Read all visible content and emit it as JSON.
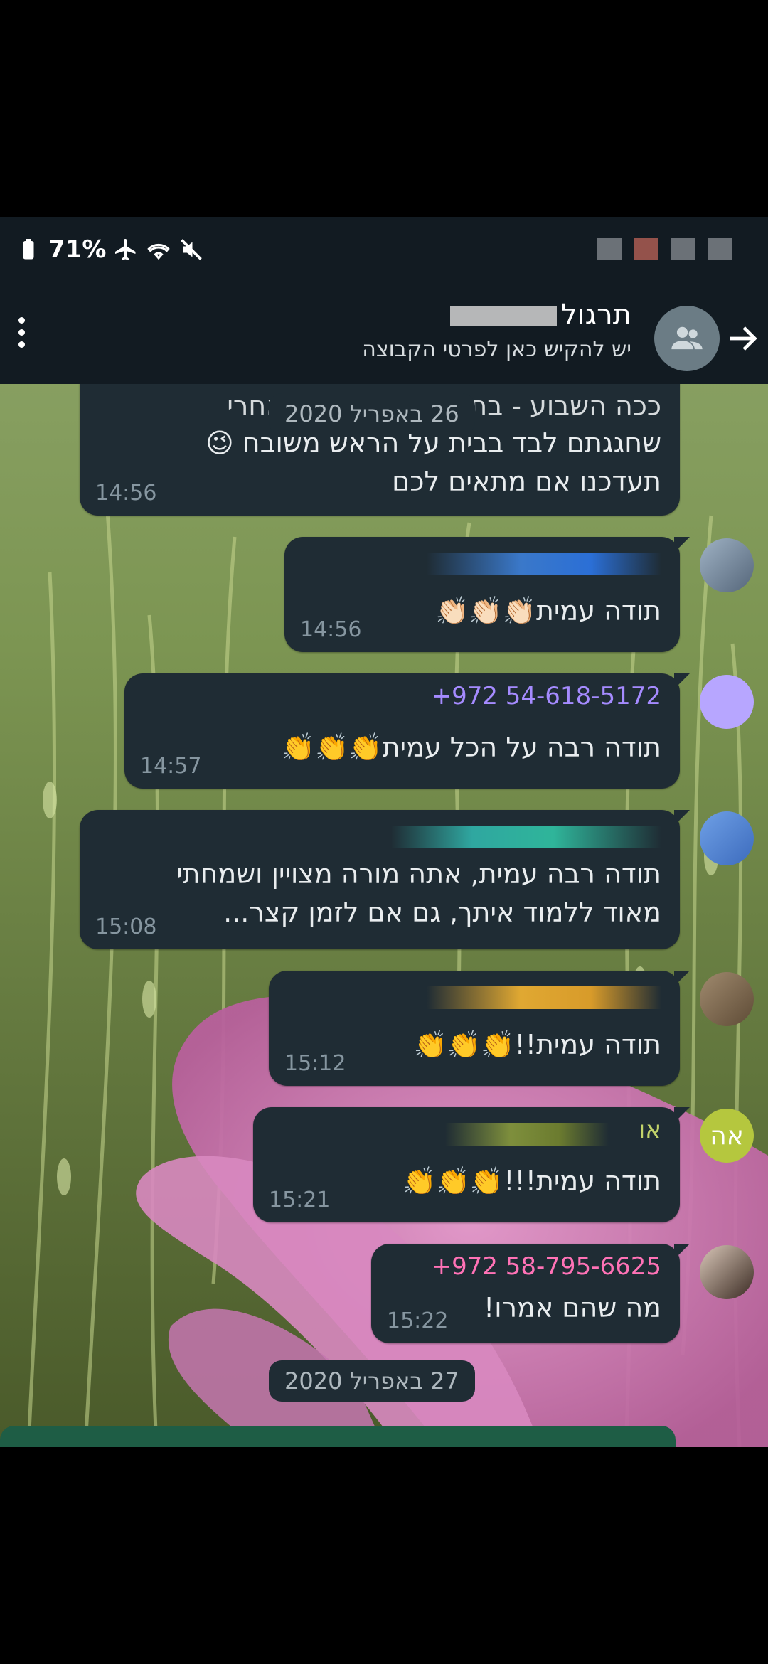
{
  "status_bar": {
    "battery": "71%",
    "icons": [
      "battery-icon",
      "airplane-icon",
      "wifi-icon",
      "mute-icon"
    ]
  },
  "header": {
    "title": "תרגול",
    "subtitle": "יש להקיש כאן לפרטי הקבוצה",
    "icons": [
      "back-arrow-icon",
      "group-icon",
      "more-vert-icon"
    ]
  },
  "chips": {
    "floating_date": "26 באפריל 2020",
    "bottom_date": "27 באפריל 2020"
  },
  "messages": [
    {
      "sender": "",
      "lines": [
        "ככה השבוע - בתהליך ההתאמות אחרי",
        "שחגגתם לבד בבית על הראש משובח 😉",
        "תעדכנו אם מתאים לכם"
      ],
      "time": "14:56"
    },
    {
      "sender": "",
      "lines": [
        "תודה עמית👏🏻👏🏻👏🏻"
      ],
      "time": "14:56"
    },
    {
      "sender": "+972 54-618-5172",
      "sender_color": "#a58bff",
      "lines": [
        "תודה רבה על הכל עמית👏👏👏"
      ],
      "time": "14:57"
    },
    {
      "sender": "",
      "lines": [
        "תודה רבה עמית, אתה מורה מצויין ושמחתי",
        "מאוד ללמוד איתך, גם אם לזמן קצר..."
      ],
      "time": "15:08"
    },
    {
      "sender": "",
      "lines": [
        "תודה עמית!!👏👏👏"
      ],
      "time": "15:12"
    },
    {
      "sender": "או",
      "sender_color": "#c2d36a",
      "lines": [
        "תודה עמית!!!👏👏👏"
      ],
      "time": "15:21",
      "avatar_text": "אה"
    },
    {
      "sender": "+972 58-795-6625",
      "sender_color": "#ff72b6",
      "lines": [
        "מה שהם אמרו!"
      ],
      "time": "15:22"
    }
  ],
  "colors": {
    "header_bg": "#121b22",
    "bubble_bg": "#1f2c34",
    "timestamp": "#8696a0"
  }
}
